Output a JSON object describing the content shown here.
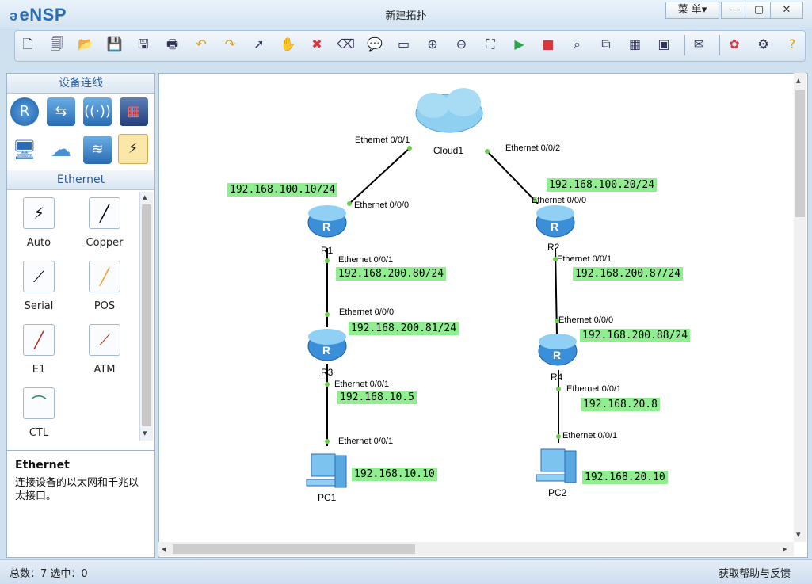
{
  "app": {
    "name": "eNSP",
    "window_title": "新建拓扑",
    "menu_label": "菜 单▾"
  },
  "window_controls": {
    "minimize": "—",
    "maximize": "▢",
    "close": "✕"
  },
  "toolbar": {
    "icons": [
      "new-topology-icon",
      "new-example-icon",
      "open-icon",
      "save-icon",
      "save-as-icon",
      "print-icon",
      "undo-icon",
      "redo-icon",
      "select-pointer-icon",
      "pan-hand-icon",
      "delete-icon",
      "delete-link-icon",
      "text-note-icon",
      "rectangle-icon",
      "zoom-in-icon",
      "zoom-out-icon",
      "fit-view-icon",
      "start-device-icon",
      "stop-device-icon",
      "capture-icon",
      "topology-icon",
      "table-icon",
      "console-icon",
      "chat-icon",
      "huawei-icon",
      "settings-icon",
      "help-icon"
    ]
  },
  "palette": {
    "header": "设备连线",
    "devices": [
      "router-icon",
      "switch-icon",
      "wireless-icon",
      "firewall-icon",
      "pc-icon",
      "cloud-icon",
      "hub-icon",
      "cable-icon"
    ],
    "subheader": "Ethernet",
    "cables": [
      {
        "label": "Auto",
        "icon": "auto-cable-icon"
      },
      {
        "label": "Copper",
        "icon": "copper-cable-icon"
      },
      {
        "label": "Serial",
        "icon": "serial-cable-icon"
      },
      {
        "label": "POS",
        "icon": "pos-cable-icon"
      },
      {
        "label": "E1",
        "icon": "e1-cable-icon"
      },
      {
        "label": "ATM",
        "icon": "atm-cable-icon"
      },
      {
        "label": "CTL",
        "icon": "ctl-cable-icon"
      }
    ]
  },
  "info": {
    "title": "Ethernet",
    "description": "连接设备的以太网和千兆以太接口。"
  },
  "topology": {
    "nodes": {
      "cloud1": "Cloud1",
      "r1": "R1",
      "r2": "R2",
      "r3": "R3",
      "r4": "R4",
      "pc1": "PC1",
      "pc2": "PC2"
    },
    "ports": {
      "cloud_r1": "Ethernet 0/0/1",
      "cloud_r2": "Ethernet 0/0/2",
      "r1_up": "Ethernet 0/0/0",
      "r2_up": "Ethernet 0/0/0",
      "r1_down": "Ethernet 0/0/1",
      "r2_down": "Ethernet 0/0/1",
      "r3_up": "Ethernet 0/0/0",
      "r4_up": "Ethernet 0/0/0",
      "r3_down": "Ethernet 0/0/1",
      "r4_down": "Ethernet 0/0/1",
      "pc1_up": "Ethernet 0/0/1",
      "pc2_up": "Ethernet 0/0/1"
    },
    "ips": {
      "r1_up": "192.168.100.10/24",
      "r2_up": "192.168.100.20/24",
      "r1_down": "192.168.200.80/24",
      "r2_down": "192.168.200.87/24",
      "r3_up": "192.168.200.81/24",
      "r4_up": "192.168.200.88/24",
      "r3_down": "192.168.10.5",
      "r4_down": "192.168.20.8",
      "pc1": "192.168.10.10",
      "pc2": "192.168.20.10"
    }
  },
  "status": {
    "text": "总数：7  选中：0",
    "help_link": "获取帮助与反馈"
  }
}
